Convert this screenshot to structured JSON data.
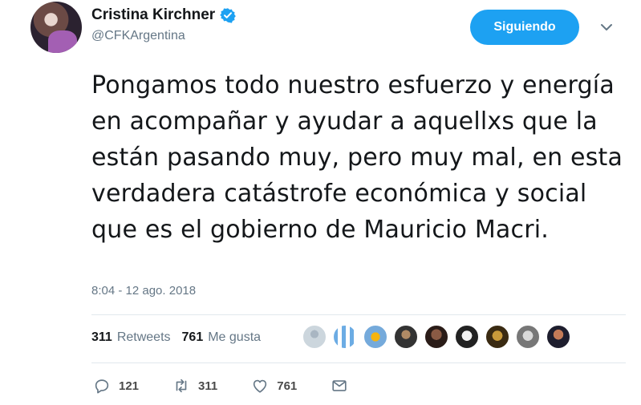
{
  "user": {
    "display_name": "Cristina Kirchner",
    "handle": "@CFKArgentina",
    "verified": true
  },
  "follow_button": {
    "label": "Siguiendo"
  },
  "tweet": {
    "text": "Pongamos todo nuestro esfuerzo y energía en acompañar y ayudar a aquellxs que la están pasando muy, pero muy mal, en esta verdadera catástrofe económica y social que es el gobierno de Mauricio Macri.",
    "timestamp": "8:04 - 12 ago. 2018"
  },
  "stats": {
    "retweets_count": "311",
    "retweets_label": "Retweets",
    "likes_count": "761",
    "likes_label": "Me gusta"
  },
  "actions": {
    "reply_count": "121",
    "retweet_count": "311",
    "like_count": "761"
  },
  "colors": {
    "accent": "#1da1f2",
    "secondary_text": "#657786",
    "primary_text": "#14171a"
  },
  "icons": [
    "verified-badge-icon",
    "chevron-down-icon",
    "reply-icon",
    "retweet-icon",
    "heart-icon",
    "mail-icon"
  ]
}
